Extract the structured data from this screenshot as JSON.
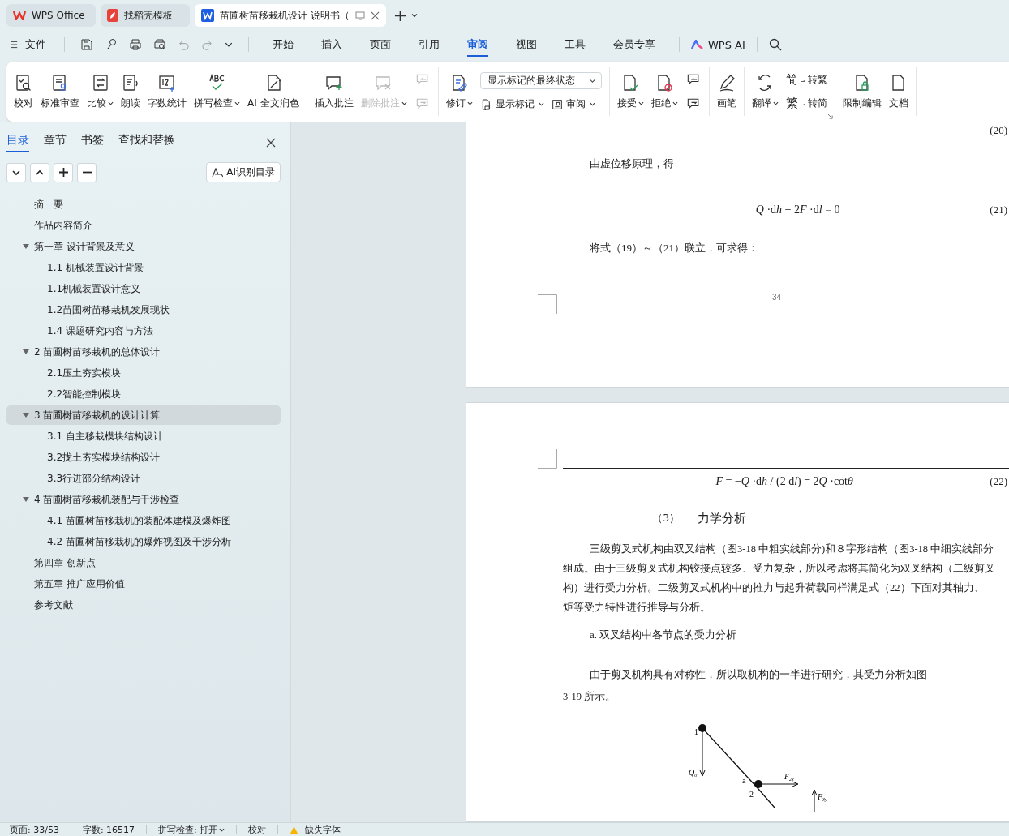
{
  "app_tabs": [
    {
      "label": "WPS Office",
      "kind": "home",
      "selected": false
    },
    {
      "label": "找稻壳模板",
      "kind": "template",
      "selected": false
    },
    {
      "label": "苗圃树苗移栽机设计 说明书（",
      "kind": "doc",
      "selected": true
    }
  ],
  "menu": {
    "file": "文件",
    "tabs": [
      {
        "label": "开始",
        "selected": false
      },
      {
        "label": "插入",
        "selected": false
      },
      {
        "label": "页面",
        "selected": false
      },
      {
        "label": "引用",
        "selected": false
      },
      {
        "label": "审阅",
        "selected": true
      },
      {
        "label": "视图",
        "selected": false
      },
      {
        "label": "工具",
        "selected": false
      },
      {
        "label": "会员专享",
        "selected": false
      }
    ],
    "ai": "WPS AI"
  },
  "ribbon": [
    {
      "items": [
        {
          "kind": "large",
          "label": "校对",
          "dropdown": false,
          "disabled": false
        },
        {
          "kind": "large",
          "label": "标准审查",
          "dropdown": false,
          "disabled": false
        },
        {
          "kind": "large",
          "label": "比较",
          "dropdown": true,
          "disabled": false
        },
        {
          "kind": "large",
          "label": "朗读",
          "dropdown": false,
          "disabled": false
        },
        {
          "kind": "large",
          "label": "字数统计",
          "dropdown": false,
          "disabled": false
        },
        {
          "kind": "large",
          "label": "拼写检查",
          "dropdown": true,
          "disabled": false
        },
        {
          "kind": "large",
          "label": "AI 全文润色",
          "dropdown": false,
          "disabled": false
        }
      ]
    },
    {
      "items": [
        {
          "kind": "large",
          "label": "插入批注",
          "dropdown": false,
          "disabled": false
        },
        {
          "kind": "large",
          "label": "删除批注",
          "dropdown": true,
          "disabled": true
        },
        {
          "kind": "stack",
          "rows": [
            [
              {
                "kind": "icon",
                "disabled": true
              }
            ],
            [
              {
                "kind": "icon",
                "disabled": true
              }
            ]
          ]
        }
      ]
    },
    {
      "items": [
        {
          "kind": "large",
          "label": "修订",
          "dropdown": true,
          "disabled": false
        },
        {
          "kind": "stack",
          "rows": [
            [
              {
                "kind": "select",
                "value": "显示标记的最终状态"
              }
            ],
            [
              {
                "kind": "small",
                "label": "显示标记",
                "dropdown": true,
                "disabled": false
              },
              {
                "kind": "small",
                "label": "审阅",
                "dropdown": true,
                "disabled": false
              }
            ]
          ]
        }
      ]
    },
    {
      "items": [
        {
          "kind": "large",
          "label": "接受",
          "dropdown": true,
          "disabled": false
        },
        {
          "kind": "large",
          "label": "拒绝",
          "dropdown": true,
          "disabled": false
        },
        {
          "kind": "stack",
          "rows": [
            [
              {
                "kind": "icon",
                "disabled": false
              }
            ],
            [
              {
                "kind": "icon",
                "disabled": false
              }
            ]
          ]
        }
      ]
    },
    {
      "items": [
        {
          "kind": "large",
          "label": "画笔",
          "dropdown": false,
          "disabled": false
        }
      ]
    },
    {
      "items": [
        {
          "kind": "large",
          "label": "翻译",
          "dropdown": true,
          "disabled": false
        },
        {
          "kind": "stack",
          "rows": [
            [
              {
                "kind": "glyph",
                "glyph": "简",
                "label": "转繁",
                "disabled": false
              }
            ],
            [
              {
                "kind": "glyph",
                "glyph": "繁",
                "label": "转简",
                "disabled": false
              }
            ]
          ]
        }
      ]
    },
    {
      "items": [
        {
          "kind": "large",
          "label": "限制编辑",
          "dropdown": false,
          "disabled": false
        },
        {
          "kind": "large",
          "label": "文档",
          "dropdown": false,
          "disabled": false
        }
      ]
    }
  ],
  "nav_panel": {
    "tabs": [
      {
        "label": "目录",
        "selected": true
      },
      {
        "label": "章节",
        "selected": false
      },
      {
        "label": "书签",
        "selected": false
      },
      {
        "label": "查找和替换",
        "selected": false
      }
    ],
    "ai_button": "AI识别目录",
    "outline": [
      {
        "label": "摘　要",
        "selected": false
      },
      {
        "label": "作品内容简介",
        "selected": false
      },
      {
        "label": "第一章  设计背景及意义",
        "selected": false,
        "expanded": true,
        "children": [
          {
            "label": "1.1 机械装置设计背景",
            "selected": false
          },
          {
            "label": "1.1机械装置设计意义",
            "selected": false
          },
          {
            "label": "1.2苗圃树苗移栽机发展现状",
            "selected": false
          },
          {
            "label": "1.4 课题研究内容与方法",
            "selected": false
          }
        ]
      },
      {
        "label": "2 苗圃树苗移栽机的总体设计",
        "selected": false,
        "expanded": true,
        "children": [
          {
            "label": "2.1压土夯实模块",
            "selected": false
          },
          {
            "label": "2.2智能控制模块",
            "selected": false
          }
        ]
      },
      {
        "label": "3 苗圃树苗移栽机的设计计算",
        "selected": true,
        "expanded": true,
        "children": [
          {
            "label": "3.1 自主移栽模块结构设计",
            "selected": false
          },
          {
            "label": "3.2拢土夯实模块结构设计",
            "selected": false
          },
          {
            "label": "3.3行进部分结构设计",
            "selected": false
          }
        ]
      },
      {
        "label": "4 苗圃树苗移栽机装配与干涉检查",
        "selected": false,
        "expanded": true,
        "children": [
          {
            "label": "4.1  苗圃树苗移栽机的装配体建模及爆炸图",
            "selected": false
          },
          {
            "label": "4.2 苗圃树苗移栽机的爆炸视图及干涉分析",
            "selected": false
          }
        ]
      },
      {
        "label": "第四章  创新点",
        "selected": false
      },
      {
        "label": "第五章  推广应用价值",
        "selected": false
      },
      {
        "label": "参考文献",
        "selected": false
      }
    ]
  },
  "document": {
    "page_1": {
      "top_eq_number": "(20)",
      "text_1": "由虚位移原理，得",
      "equation": [
        {
          "text": "Q",
          "italic": true
        },
        {
          "text": " ·d",
          "italic": false
        },
        {
          "text": "h",
          "italic": true
        },
        {
          "text": " + 2",
          "italic": false
        },
        {
          "text": "F",
          "italic": true
        },
        {
          "text": " ·d",
          "italic": false
        },
        {
          "text": "l",
          "italic": true
        },
        {
          "text": " = 0",
          "italic": false
        }
      ],
      "eq_number": "(21)",
      "text_2": "将式（19）～（21）联立，可求得：",
      "page_number": "34"
    },
    "page_2": {
      "equation": [
        {
          "text": "F",
          "italic": true
        },
        {
          "text": " = −",
          "italic": false
        },
        {
          "text": "Q",
          "italic": true
        },
        {
          "text": " ·d",
          "italic": false
        },
        {
          "text": "h",
          "italic": true
        },
        {
          "text": " / (2 d",
          "italic": false
        },
        {
          "text": "l",
          "italic": true
        },
        {
          "text": ") = 2",
          "italic": false
        },
        {
          "text": "Q",
          "italic": true
        },
        {
          "text": " ·cot",
          "italic": false
        },
        {
          "text": "θ",
          "italic": true
        }
      ],
      "eq_number": "(22)",
      "heading_number": "（3）",
      "heading": "力学分析",
      "paragraph_1": [
        "三级剪叉式机构由双叉结构（图3-18  中粗实线部分)和８字形结构（图3-18  中细实线部分",
        "组成。由于三级剪叉式机构铰接点较多、受力复杂，所以考虑将其简化为双叉结构（二级剪叉",
        "构）进行受力分析。二级剪叉式机构中的推力与起升荷载同样满足式（22）下面对其轴力、",
        "矩等受力特性进行推导与分析。"
      ],
      "subheading": "a.  双叉结构中各节点的受力分析",
      "paragraph_2": [
        "由于剪叉机构具有对称性，所以取机构的一半进行研究，其受力分析如图",
        "3-19  所示。"
      ],
      "figure_labels": [
        {
          "text": "1"
        },
        {
          "text": "Q",
          "sub": "0"
        },
        {
          "text": "a"
        },
        {
          "text": "2"
        },
        {
          "text": "F",
          "sub": "2x"
        },
        {
          "text": "F",
          "sub": "3y"
        }
      ]
    }
  },
  "status_bar": [
    {
      "kind": "text",
      "label": "页面: 33/53"
    },
    {
      "kind": "text",
      "label": "字数: 16517"
    },
    {
      "kind": "dropdown",
      "label": "拼写检查: 打开"
    },
    {
      "kind": "text",
      "label": "校对"
    },
    {
      "kind": "warning",
      "label": "缺失字体"
    }
  ]
}
